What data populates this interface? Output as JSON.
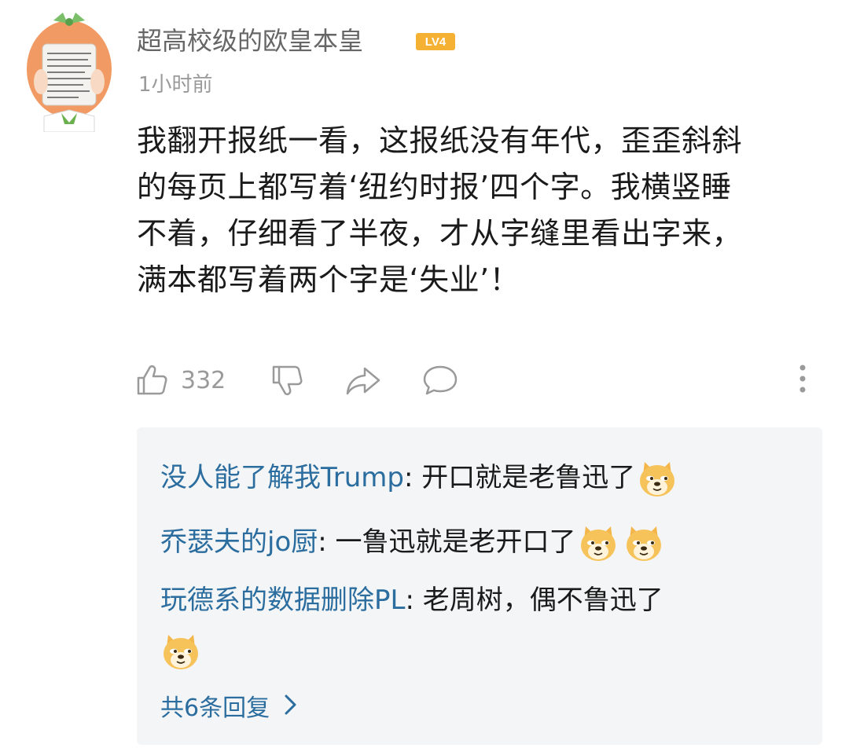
{
  "comment": {
    "username": "超高校级的欧皇本皇",
    "level": "LV4",
    "timestamp": "1小时前",
    "text": "我翻开报纸一看，这报纸没有年代，歪歪斜斜\n的每页上都写着‘纽约时报’四个字。我横竖睡\n不着，仔细看了半夜，才从字缝里看出字来，\n满本都写着两个字是‘失业’！",
    "likes": "332"
  },
  "replies": [
    {
      "name": "没人能了解我Trump",
      "sep": ": ",
      "text": "开口就是老鲁迅了",
      "emojis": [
        "doge-emoji"
      ]
    },
    {
      "name": "乔瑟夫的jo厨",
      "sep": ": ",
      "text": "一鲁迅就是老开口了",
      "emojis": [
        "doge-emoji",
        "doge-emoji"
      ]
    },
    {
      "name": "玩德系的数据删除PL",
      "sep": ": ",
      "text": "老周树，偶不鲁迅了",
      "emojis": [
        "doge-emoji"
      ]
    }
  ],
  "view_all": "共6条回复",
  "colors": {
    "reply_name": "#2b6d9e",
    "meta_gray": "#9a9a9a",
    "reply_bg": "#f4f5f7",
    "level_badge": "#f5b133"
  }
}
